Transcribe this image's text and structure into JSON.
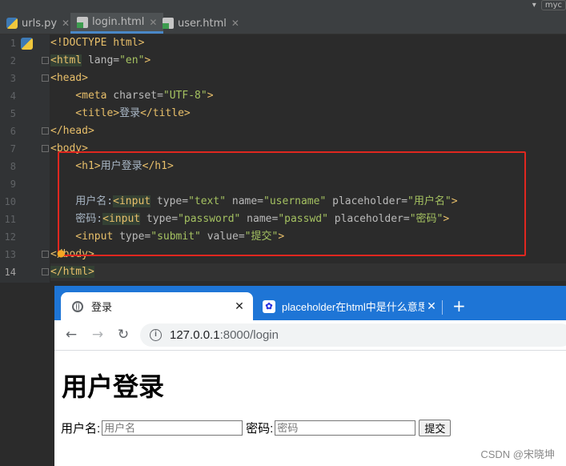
{
  "ide": {
    "tabs": [
      {
        "label": "urls.py",
        "icon": "python-file-icon"
      },
      {
        "label": "login.html",
        "icon": "html-file-icon"
      },
      {
        "label": "user.html",
        "icon": "html-file-icon"
      }
    ],
    "top_right_project": "myc"
  },
  "editor": {
    "line_numbers": [
      "1",
      "2",
      "3",
      "4",
      "5",
      "6",
      "7",
      "8",
      "9",
      "10",
      "11",
      "12",
      "13",
      "14"
    ],
    "lines": {
      "l1": "<!DOCTYPE html>",
      "l2_tag": "<html",
      "l2_attr": " lang=",
      "l2_val": "\"en\"",
      "l2_end": ">",
      "l3": "<head>",
      "l4_tag": "    <meta",
      "l4_attr": " charset=",
      "l4_val": "\"UTF-8\"",
      "l4_end": ">",
      "l5_open": "    <title>",
      "l5_text": "登录",
      "l5_close": "</title>",
      "l6": "</head>",
      "l7": "<body>",
      "l8_open": "    <h1>",
      "l8_text": "用户登录",
      "l8_close": "</h1>",
      "l10_text": "    用户名:",
      "l10_tag": "<input",
      "l10_a1": " type=",
      "l10_v1": "\"text\"",
      "l10_a2": " name=",
      "l10_v2": "\"username\"",
      "l10_a3": " placeholder=",
      "l10_v3": "\"用户名\"",
      "l10_end": ">",
      "l11_text": "    密码:",
      "l11_tag": "<input",
      "l11_a1": " type=",
      "l11_v1": "\"password\"",
      "l11_a2": " name=",
      "l11_v2": "\"passwd\"",
      "l11_a3": " placeholder=",
      "l11_v3": "\"密码\"",
      "l11_end": ">",
      "l12_tag": "    <input",
      "l12_a1": " type=",
      "l12_v1": "\"submit\"",
      "l12_a2": " value=",
      "l12_v2": "\"提交\"",
      "l12_end": ">",
      "l13": "</body>",
      "l14": "</html>"
    }
  },
  "browser": {
    "active_tab": "登录",
    "inactive_tab": "placeholder在html中是什么意思",
    "url_host": "127.0.0.1",
    "url_rest": ":8000/login",
    "page": {
      "heading": "用户登录",
      "username_label": "用户名:",
      "username_placeholder": "用户名",
      "password_label": "密码:",
      "password_placeholder": "密码",
      "submit_value": "提交"
    }
  },
  "watermark": "CSDN @宋晓坤",
  "colors": {
    "highlight_box": "#e0271f",
    "browser_tabstrip": "#1e75d6"
  }
}
